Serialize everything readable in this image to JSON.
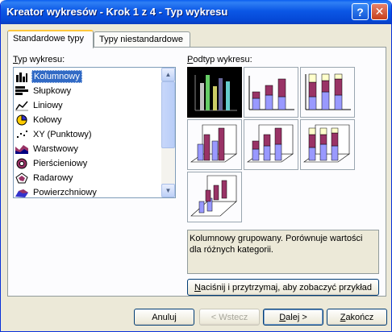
{
  "window": {
    "title": "Kreator wykresów - Krok 1 z 4 - Typ wykresu",
    "help_label": "?",
    "close_label": "✕"
  },
  "tabs": [
    {
      "label": "Standardowe typy",
      "active": true
    },
    {
      "label": "Typy niestandardowe",
      "active": false
    }
  ],
  "chart_type": {
    "label_underlined": "T",
    "label_rest": "yp wykresu:",
    "items": [
      {
        "label": "Kolumnowy",
        "icon": "column-chart-icon",
        "selected": true
      },
      {
        "label": "Słupkowy",
        "icon": "bar-chart-icon",
        "selected": false
      },
      {
        "label": "Liniowy",
        "icon": "line-chart-icon",
        "selected": false
      },
      {
        "label": "Kołowy",
        "icon": "pie-chart-icon",
        "selected": false
      },
      {
        "label": "XY (Punktowy)",
        "icon": "scatter-chart-icon",
        "selected": false
      },
      {
        "label": "Warstwowy",
        "icon": "area-chart-icon",
        "selected": false
      },
      {
        "label": "Pierścieniowy",
        "icon": "doughnut-chart-icon",
        "selected": false
      },
      {
        "label": "Radarowy",
        "icon": "radar-chart-icon",
        "selected": false
      },
      {
        "label": "Powierzchniowy",
        "icon": "surface-chart-icon",
        "selected": false
      }
    ]
  },
  "subtype": {
    "label_underlined": "P",
    "label_rest": "odtyp wykresu:",
    "items": [
      {
        "name": "clustered-column",
        "selected": true
      },
      {
        "name": "stacked-column",
        "selected": false
      },
      {
        "name": "100-stacked-column",
        "selected": false
      },
      {
        "name": "3d-clustered-column",
        "selected": false
      },
      {
        "name": "3d-stacked-column",
        "selected": false
      },
      {
        "name": "3d-100-stacked-column",
        "selected": false
      },
      {
        "name": "3d-column",
        "selected": false
      }
    ],
    "description": "Kolumnowy grupowany. Porównuje wartości dla różnych kategorii.",
    "preview_button_underlined": "N",
    "preview_button_rest": "aciśnij i przytrzymaj, aby zobaczyć przykład"
  },
  "buttons": {
    "cancel": "Anuluj",
    "back": "< Wstecz",
    "next_underlined": "D",
    "next_rest": "alej >",
    "finish_underlined": "Z",
    "finish_rest": "akończ"
  },
  "colors": {
    "title_bar": "#0548d6",
    "selection": "#316ac5",
    "bar_purple": "#993366",
    "bar_lavender": "#9999ff",
    "bar_cream": "#ffffcc"
  }
}
